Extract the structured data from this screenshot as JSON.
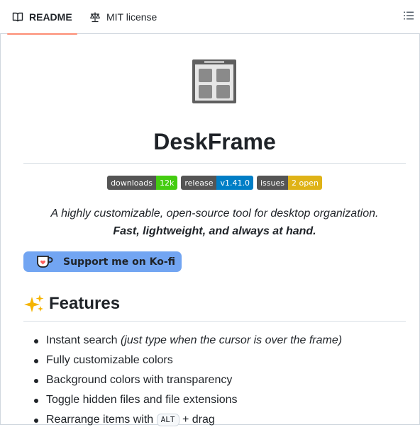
{
  "tabs": [
    {
      "label": "README",
      "icon": "book-icon",
      "active": true
    },
    {
      "label": "MIT license",
      "icon": "scale-icon",
      "active": false
    }
  ],
  "outline_icon": "outline-list-icon",
  "readme": {
    "logo_icon": "window-grid-icon",
    "title": "DeskFrame",
    "badges": [
      {
        "label": "downloads",
        "value": "12k",
        "color": "#4c1"
      },
      {
        "label": "release",
        "value": "v1.41.0",
        "color": "#007ec6"
      },
      {
        "label": "issues",
        "value": "2 open",
        "color": "#dfb317"
      }
    ],
    "tagline": "A highly customizable, open-source tool for desktop organization.",
    "tagline_bold": "Fast, lightweight, and always at hand.",
    "kofi_label": "Support me on Ko-fi",
    "features_heading": "Features",
    "features_emoji": "sparkles-icon",
    "features": [
      {
        "text": "Instant search ",
        "italic": "(just type when the cursor is over the frame)"
      },
      {
        "text": "Fully customizable colors"
      },
      {
        "text": "Background colors with transparency"
      },
      {
        "text": "Toggle hidden files and file extensions"
      },
      {
        "text": "Rearrange items with ",
        "kbd": "ALT",
        "after": " + drag"
      }
    ]
  }
}
